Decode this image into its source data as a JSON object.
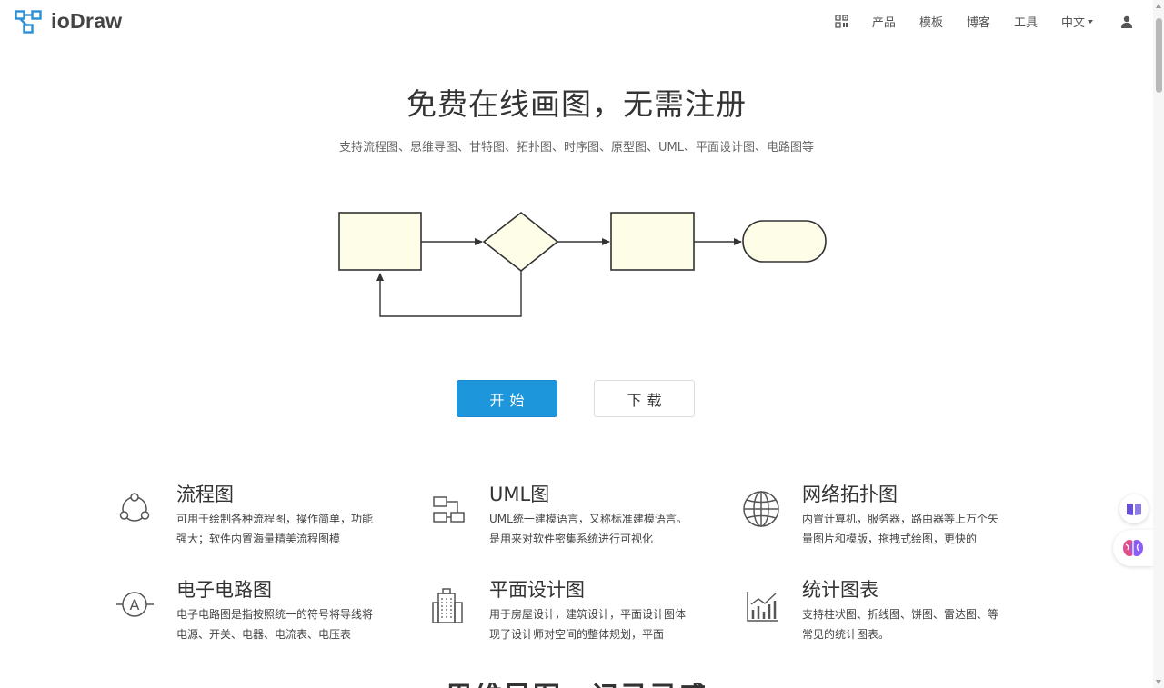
{
  "header": {
    "logo_text": "ioDraw",
    "nav": {
      "products": "产品",
      "templates": "模板",
      "blog": "博客",
      "tools": "工具",
      "language": "中文"
    }
  },
  "hero": {
    "title": "免费在线画图，无需注册",
    "subtitle": "支持流程图、思维导图、甘特图、拓扑图、时序图、原型图、UML、平面设计图、电路图等"
  },
  "buttons": {
    "start": "开始",
    "download": "下载"
  },
  "features": [
    {
      "title": "流程图",
      "desc": "可用于绘制各种流程图，操作简单，功能强大；软件内置海量精美流程图模",
      "icon": "flowchart-icon"
    },
    {
      "title": "UML图",
      "desc": "UML统一建模语言，又称标准建模语言。是用来对软件密集系统进行可视化",
      "icon": "uml-icon"
    },
    {
      "title": "网络拓扑图",
      "desc": "内置计算机，服务器，路由器等上万个矢量图片和模版，拖拽式绘图，更快的",
      "icon": "globe-icon"
    },
    {
      "title": "电子电路图",
      "desc": "电子电路图是指按照统一的符号将导线将电源、开关、电器、电流表、电压表",
      "icon": "ammeter-icon"
    },
    {
      "title": "平面设计图",
      "desc": "用于房屋设计，建筑设计，平面设计图体现了设计师对空间的整体规划，平面",
      "icon": "building-icon"
    },
    {
      "title": "统计图表",
      "desc": "支持柱状图、折线图、饼图、雷达图、等常见的统计图表。",
      "icon": "bar-chart-icon"
    }
  ],
  "section": {
    "title": "思维导图，记录灵感"
  },
  "colors": {
    "primary": "#1e96dc",
    "logo": "#2a8fd6",
    "shape_fill": "#fdfde8",
    "shape_stroke": "#333333"
  }
}
